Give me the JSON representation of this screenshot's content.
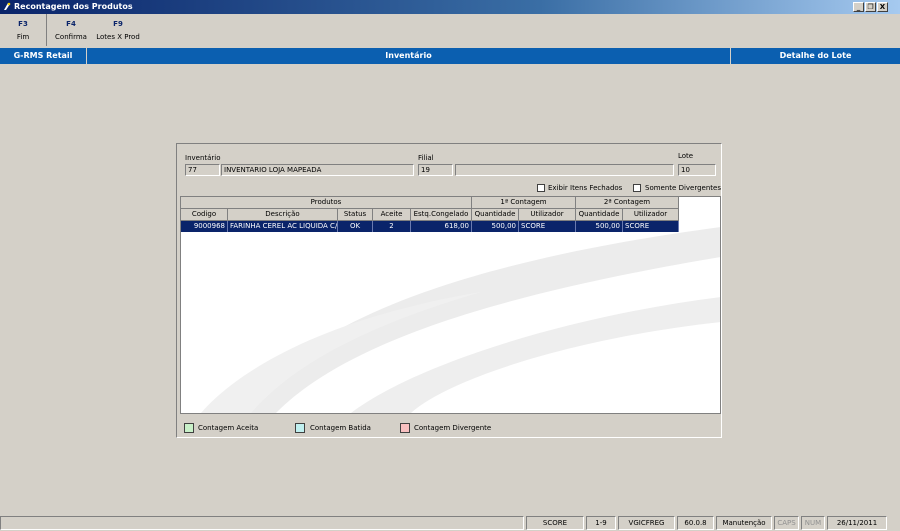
{
  "window": {
    "title": "Recontagem dos Produtos",
    "buttons": [
      "_",
      "Ц",
      "X"
    ]
  },
  "toolbar": [
    {
      "key": "F3",
      "label": "Fim"
    },
    {
      "key": "F4",
      "label": "Confirma"
    },
    {
      "key": "F9",
      "label": "Lotes X Prod"
    }
  ],
  "band": {
    "left": "G-RMS Retail",
    "center": "Inventário",
    "right": "Detalhe do Lote"
  },
  "form": {
    "inventario_label": "Inventário",
    "inventario_code": "77",
    "inventario_name": "INVENTARIO LOJA MAPEADA",
    "filial_label": "Filial",
    "filial_code": "19",
    "filial_name": "",
    "lote_label": "Lote",
    "lote_value": "10",
    "exibir_label": "Exibir Itens Fechados",
    "somente_label": "Somente Divergentes"
  },
  "grid": {
    "group_produtos": "Produtos",
    "group_contagem1": "1ª Contagem",
    "group_contagem2": "2ª Contagem",
    "columns": [
      "Codigo",
      "Descrição",
      "Status",
      "Aceite",
      "Estq.Congelado",
      "Quantidade",
      "Utilizador",
      "Quantidade",
      "Utilizador"
    ],
    "rows": [
      [
        "9000968",
        "FARINHA CEREL AC LIQUIDA C/",
        "OK",
        "2",
        "618,00",
        "500,00",
        "SCORE",
        "500,00",
        "SCORE"
      ]
    ]
  },
  "legend": {
    "aceita": "Contagem Aceita",
    "batida": "Contagem Batida",
    "divergente": "Contagem Divergente",
    "colors": {
      "aceita": "#c8f0c8",
      "batida": "#c0f0f0",
      "divergente": "#f8c0c0"
    }
  },
  "status": [
    "SCORE",
    "1-9",
    "VGICFREG",
    "60.0.8",
    "Manutenção",
    "CAPS",
    "NUM",
    "26/11/2011"
  ]
}
